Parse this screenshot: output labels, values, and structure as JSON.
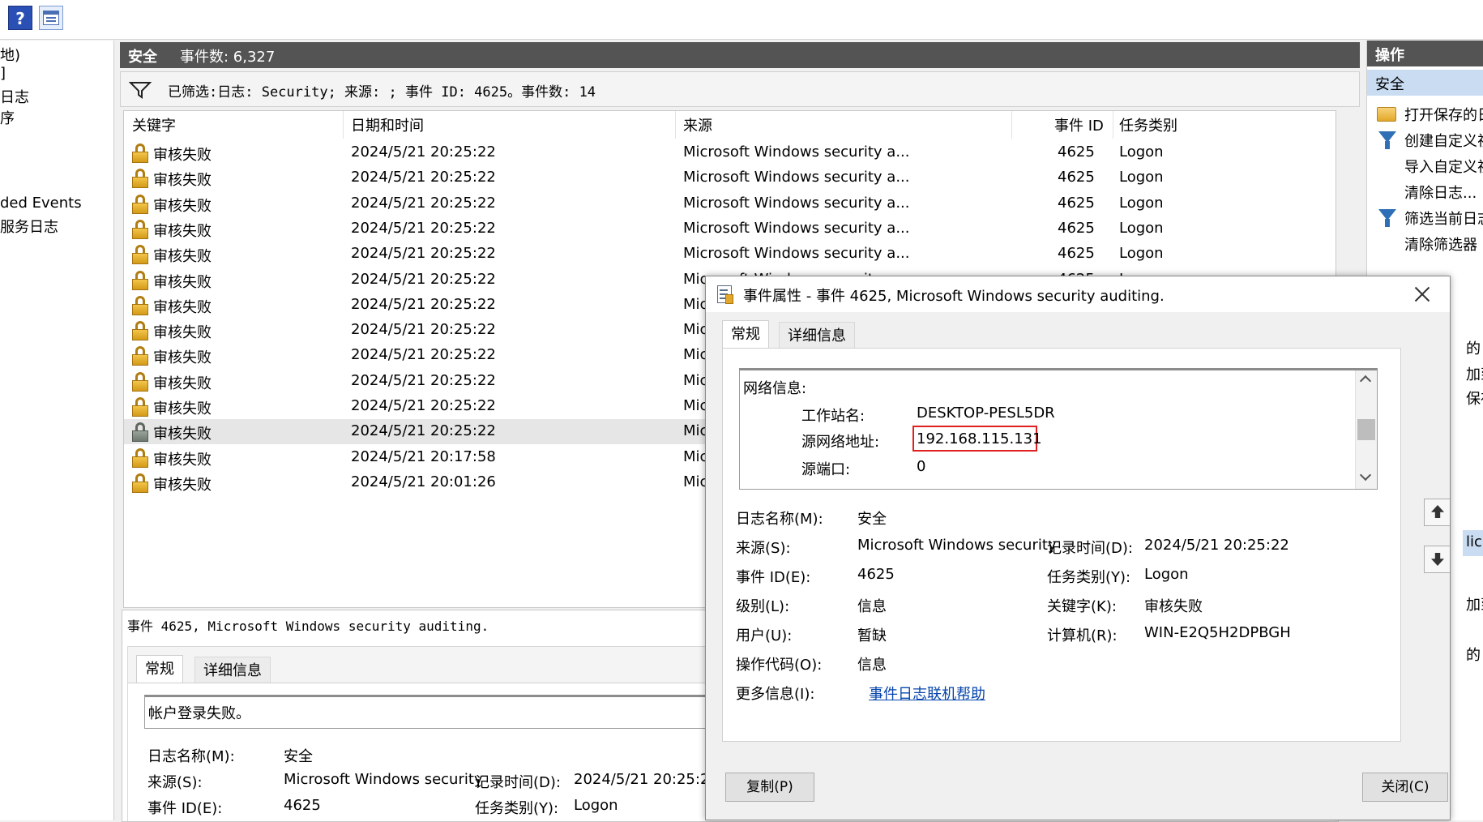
{
  "toolbar": {
    "help_icon": "help-icon",
    "view_icon": "view-panel-icon",
    "help_glyph": "?"
  },
  "tree": {
    "items": [
      "地)",
      "]",
      "日志",
      "序",
      "ded Events",
      "服务日志"
    ]
  },
  "center": {
    "log_name": "安全",
    "event_count": "事件数: 6,327",
    "filter_text": "已筛选:日志: Security; 来源: ; 事件 ID: 4625。事件数: 14"
  },
  "table": {
    "headers": [
      "关键字",
      "日期和时间",
      "来源",
      "事件 ID",
      "任务类别"
    ],
    "rows": [
      {
        "keyword": "审核失败",
        "datetime": "2024/5/21 20:25:22",
        "source": "Microsoft Windows security a...",
        "event_id": "4625",
        "task": "Logon"
      },
      {
        "keyword": "审核失败",
        "datetime": "2024/5/21 20:25:22",
        "source": "Microsoft Windows security a...",
        "event_id": "4625",
        "task": "Logon"
      },
      {
        "keyword": "审核失败",
        "datetime": "2024/5/21 20:25:22",
        "source": "Microsoft Windows security a...",
        "event_id": "4625",
        "task": "Logon"
      },
      {
        "keyword": "审核失败",
        "datetime": "2024/5/21 20:25:22",
        "source": "Microsoft Windows security a...",
        "event_id": "4625",
        "task": "Logon"
      },
      {
        "keyword": "审核失败",
        "datetime": "2024/5/21 20:25:22",
        "source": "Microsoft Windows security a...",
        "event_id": "4625",
        "task": "Logon"
      },
      {
        "keyword": "审核失败",
        "datetime": "2024/5/21 20:25:22",
        "source": "Microsoft Windows security a...",
        "event_id": "4625",
        "task": "Logon"
      },
      {
        "keyword": "审核失败",
        "datetime": "2024/5/21 20:25:22",
        "source": "Micr",
        "event_id": "",
        "task": ""
      },
      {
        "keyword": "审核失败",
        "datetime": "2024/5/21 20:25:22",
        "source": "Micr",
        "event_id": "",
        "task": ""
      },
      {
        "keyword": "审核失败",
        "datetime": "2024/5/21 20:25:22",
        "source": "Micr",
        "event_id": "",
        "task": ""
      },
      {
        "keyword": "审核失败",
        "datetime": "2024/5/21 20:25:22",
        "source": "Micr",
        "event_id": "",
        "task": ""
      },
      {
        "keyword": "审核失败",
        "datetime": "2024/5/21 20:25:22",
        "source": "Micr",
        "event_id": "",
        "task": ""
      },
      {
        "keyword": "审核失败",
        "datetime": "2024/5/21 20:25:22",
        "source": "Micr",
        "event_id": "",
        "task": "",
        "selected": true
      },
      {
        "keyword": "审核失败",
        "datetime": "2024/5/21 20:17:58",
        "source": "Micr",
        "event_id": "",
        "task": ""
      },
      {
        "keyword": "审核失败",
        "datetime": "2024/5/21 20:01:26",
        "source": "Micr",
        "event_id": "",
        "task": ""
      }
    ]
  },
  "preview": {
    "title": "事件 4625, Microsoft Windows security auditing.",
    "tabs": [
      "常规",
      "详细信息"
    ],
    "description": "帐户登录失败。",
    "fields": {
      "log_name_label": "日志名称(M):",
      "log_name_value": "安全",
      "source_label": "来源(S):",
      "source_value": "Microsoft Windows security",
      "logged_label": "记录时间(D):",
      "logged_value": "2024/5/21 20:25:22",
      "event_id_label": "事件 ID(E):",
      "event_id_value": "4625",
      "task_label": "任务类别(Y):",
      "task_value": "Logon"
    }
  },
  "actions": {
    "header": "操作",
    "section": "安全",
    "items": [
      "打开保存的日",
      "创建自定义视",
      "导入自定义视",
      "清除日志...",
      "筛选当前日志",
      "清除筛选器"
    ],
    "partial_right": [
      "的",
      "加到",
      "保存",
      "lic",
      "加到",
      "的"
    ]
  },
  "dialog": {
    "title": "事件属性 - 事件 4625, Microsoft Windows security auditing.",
    "tabs": [
      "常规",
      "详细信息"
    ],
    "network": {
      "heading": "网络信息:",
      "workstation_label": "工作站名:",
      "workstation_value": "DESKTOP-PESL5DR",
      "src_addr_label": "源网络地址:",
      "src_addr_value": "192.168.115.131",
      "src_port_label": "源端口:",
      "src_port_value": "0"
    },
    "fields": {
      "log_name_label": "日志名称(M):",
      "log_name_value": "安全",
      "source_label": "来源(S):",
      "source_value": "Microsoft Windows security",
      "logged_label": "记录时间(D):",
      "logged_value": "2024/5/21 20:25:22",
      "event_id_label": "事件 ID(E):",
      "event_id_value": "4625",
      "task_label": "任务类别(Y):",
      "task_value": "Logon",
      "level_label": "级别(L):",
      "level_value": "信息",
      "keywords_label": "关键字(K):",
      "keywords_value": "审核失败",
      "user_label": "用户(U):",
      "user_value": "暂缺",
      "computer_label": "计算机(R):",
      "computer_value": "WIN-E2Q5H2DPBGH",
      "opcode_label": "操作代码(O):",
      "opcode_value": "信息",
      "more_info_label": "更多信息(I):",
      "more_info_link": "事件日志联机帮助"
    },
    "copy_button": "复制(P)",
    "close_button": "关闭(C)"
  },
  "colors": {
    "highlight": "#e01f1f",
    "header_bg": "#545454",
    "selection": "#c9dcf2",
    "link": "#0645ad"
  }
}
